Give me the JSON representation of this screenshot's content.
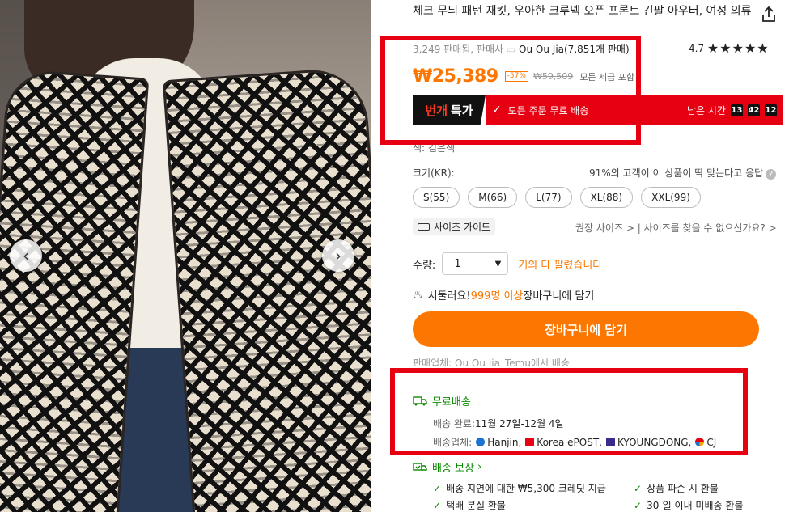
{
  "product": {
    "title": "체크 무늬 패턴 재킷, 우아한 크루넥 오픈 프론트 긴팔 아우터, 여성 의류",
    "sold": "3,249 판매됨, 판매사",
    "seller": "Ou Ou Jia(7,851개 판매)",
    "rating": "4.7",
    "stars": "★★★★★"
  },
  "price": {
    "current": "₩25,389",
    "discount": "-57%",
    "original": "₩59,509",
    "tax_note": "모든 세금 포함"
  },
  "flash": {
    "tag_highlight": "번개",
    "tag_text": "특가",
    "free_shipping": "모든 주문 무료 배송",
    "remaining_label": "남은 시간",
    "hours": "13",
    "minutes": "42",
    "seconds": "12"
  },
  "color_row": "색: 검은색",
  "size": {
    "label": "크기(KR):",
    "fit_note": "91%의 고객이 이 상품이 딱 맞는다고 응답",
    "options": [
      "S(55)",
      "M(66)",
      "L(77)",
      "XL(88)",
      "XXL(99)"
    ],
    "guide": "사이즈 가이드",
    "recommend_links": "권장 사이즈 > | 사이즈를 찾을 수 없으신가요? >"
  },
  "quantity": {
    "label": "수량:",
    "value": "1",
    "stock_note": "거의 다 팔렸습니다"
  },
  "hurry": {
    "prefix": "서둘러요!",
    "count": "999명 이상",
    "suffix": " 장바구니에 담기"
  },
  "cart_button": "장바구니에 담기",
  "sold_by": "판매업체: Ou Ou Jia_Temu에서 배송",
  "shipping": {
    "title": "무료배송",
    "date_label": "배송 완료:",
    "date_value": "11월 27일-12월 4일",
    "carriers_label": "배송업체:",
    "carriers": [
      "Hanjin,",
      "Korea ePOST,",
      "KYOUNGDONG,",
      "CJ"
    ]
  },
  "protection": {
    "title": "배송 보상",
    "items": [
      "배송 지연에 대한 ₩5,300 크레딧 지급",
      "상품 파손 시 환불",
      "택배 분실 환불",
      "30-일 이내 미배송 환불"
    ]
  },
  "colors": {
    "accent_orange": "#fb7701",
    "flash_red": "#e60012",
    "ship_green": "#0a8a00"
  }
}
